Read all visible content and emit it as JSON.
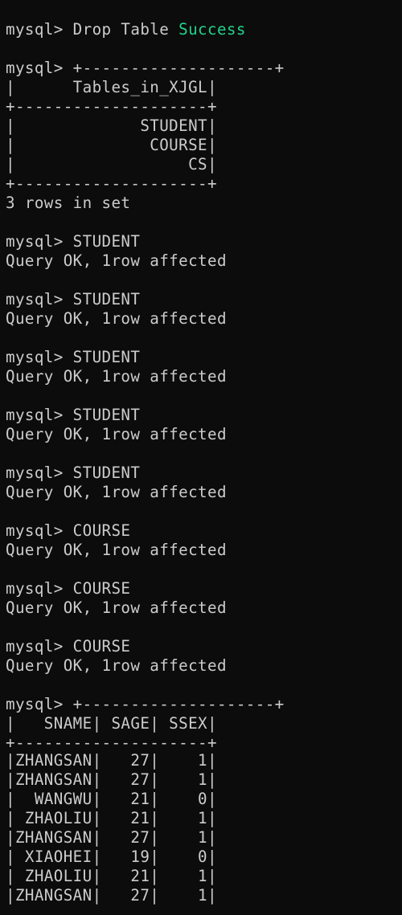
{
  "terminal": {
    "prompt": "mysql> ",
    "drop": {
      "command": "Drop Table",
      "status": "Success",
      "status_color": "#23d18b"
    },
    "tables_output": {
      "border_top_first": "+--------------------+",
      "header": "|      Tables_in_XJGL|",
      "border": "+--------------------+",
      "rows": [
        "|             STUDENT|",
        "|              COURSE|",
        "|                  CS|"
      ],
      "summary": "3 rows in set"
    },
    "inserts": [
      {
        "command": "STUDENT",
        "result": "Query OK, 1row affected"
      },
      {
        "command": "STUDENT",
        "result": "Query OK, 1row affected"
      },
      {
        "command": "STUDENT",
        "result": "Query OK, 1row affected"
      },
      {
        "command": "STUDENT",
        "result": "Query OK, 1row affected"
      },
      {
        "command": "STUDENT",
        "result": "Query OK, 1row affected"
      },
      {
        "command": "COURSE",
        "result": "Query OK, 1row affected"
      },
      {
        "command": "COURSE",
        "result": "Query OK, 1row affected"
      },
      {
        "command": "COURSE",
        "result": "Query OK, 1row affected"
      }
    ],
    "select_output": {
      "border_top_first": "+--------------------+",
      "header": "|   SNAME| SAGE| SSEX|",
      "border": "+--------------------+",
      "rows": [
        "|ZHANGSAN|   27|    1|",
        "|ZHANGSAN|   27|    1|",
        "|  WANGWU|   21|    0|",
        "| ZHAOLIU|   21|    1|",
        "|ZHANGSAN|   27|    1|",
        "| XIAOHEI|   19|    0|",
        "| ZHAOLIU|   21|    1|",
        "|ZHANGSAN|   27|    1|"
      ]
    }
  }
}
